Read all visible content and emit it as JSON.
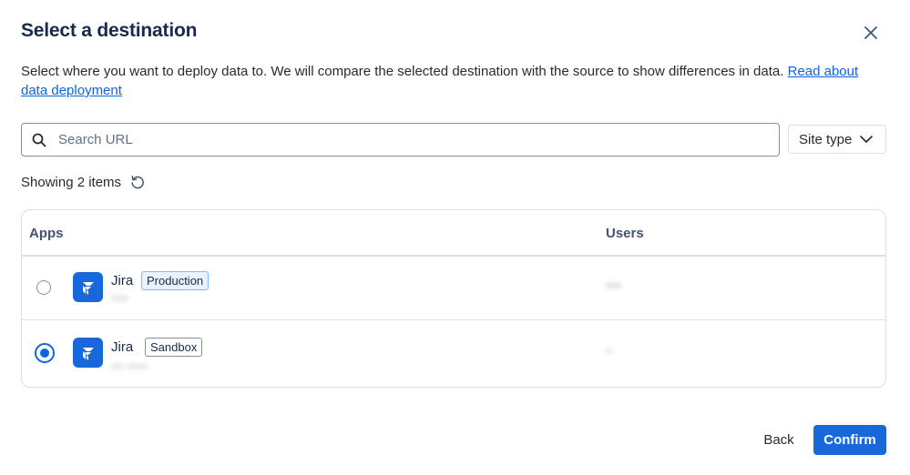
{
  "dialog": {
    "title": "Select a destination",
    "description": "Select where you want to deploy data to. We will compare the selected destination with the source to show differences in data.",
    "link_text_line1": "Read about",
    "link_text_line2": "data deployment"
  },
  "search": {
    "placeholder": "Search URL",
    "value": ""
  },
  "filter": {
    "site_type_label": "Site type"
  },
  "results": {
    "showing_label": "Showing 2 items"
  },
  "table": {
    "columns": [
      "Apps",
      "Users"
    ],
    "rows": [
      {
        "app": "Jira",
        "environment": "Production",
        "selected": false,
        "subtitle_blurred": "••••",
        "users_blurred": "•••"
      },
      {
        "app": "Jira",
        "environment": "Sandbox",
        "selected": true,
        "subtitle_blurred": "••• •••••",
        "users_blurred": "•"
      }
    ]
  },
  "footer": {
    "back_label": "Back",
    "confirm_label": "Confirm"
  },
  "colors": {
    "primary": "#1868db",
    "link": "#0c66e4",
    "production_bg": "#e9f2ff"
  }
}
